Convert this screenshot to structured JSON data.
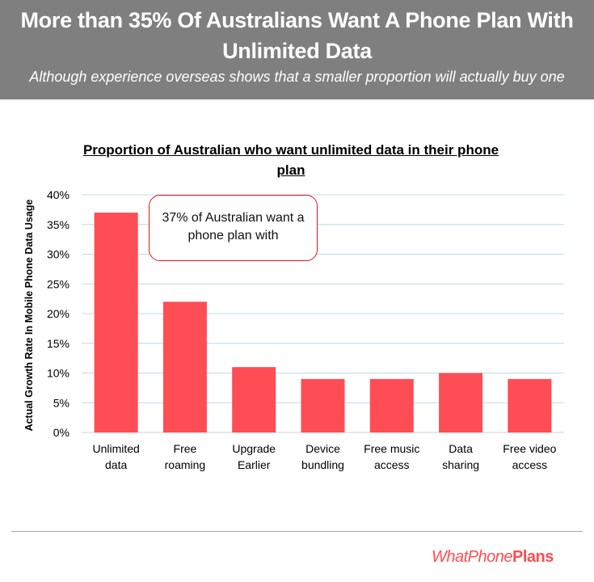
{
  "header": {
    "title": "More than 35% Of Australians Want A Phone Plan With Unlimited Data",
    "subtitle": "Although experience overseas shows that a smaller proportion will actually buy one"
  },
  "callout": {
    "text": "37% of Australian want a phone plan with"
  },
  "logo": {
    "part1": "WhatPhone",
    "part2": "Plans"
  },
  "colors": {
    "header_bg": "#7f7f7f",
    "bar": "#ff4d55",
    "grid": "#bcdceb",
    "callout_border": "#e0161b",
    "logo": "#ff4d52"
  },
  "chart_data": {
    "type": "bar",
    "title": "Proportion of Australian who want unlimited data in their phone plan",
    "xlabel": "",
    "ylabel": "Actual Growth Rate In Mobile Phone Data Usage",
    "categories": [
      "Unlimited data",
      "Free roaming",
      "Upgrade Earlier",
      "Device bundling",
      "Free music access",
      "Data sharing",
      "Free video access"
    ],
    "category_lines": [
      [
        "Unlimited",
        "data"
      ],
      [
        "Free",
        "roaming"
      ],
      [
        "Upgrade",
        "Earlier"
      ],
      [
        "Device",
        "bundling"
      ],
      [
        "Free music",
        "access"
      ],
      [
        "Data",
        "sharing"
      ],
      [
        "Free video",
        "access"
      ]
    ],
    "values": [
      37,
      22,
      11,
      9,
      9,
      10,
      9
    ],
    "value_unit": "%",
    "ylim": [
      0,
      40
    ],
    "yticks": [
      0,
      5,
      10,
      15,
      20,
      25,
      30,
      35,
      40
    ],
    "ytick_labels": [
      "0%",
      "5%",
      "10%",
      "15%",
      "20%",
      "25%",
      "30%",
      "35%",
      "40%"
    ],
    "grid": true,
    "legend": "none"
  }
}
